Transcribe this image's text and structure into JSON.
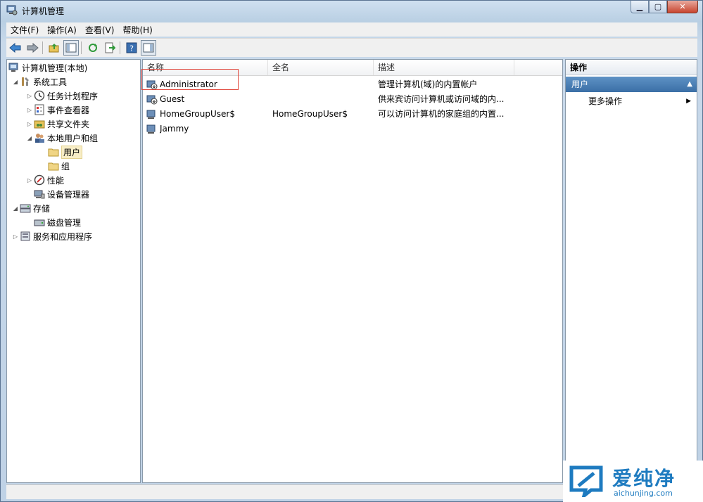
{
  "window": {
    "title": "计算机管理"
  },
  "menu": [
    "文件(F)",
    "操作(A)",
    "查看(V)",
    "帮助(H)"
  ],
  "tree": {
    "root": "计算机管理(本地)",
    "items": [
      {
        "label": "系统工具"
      },
      {
        "label": "任务计划程序"
      },
      {
        "label": "事件查看器"
      },
      {
        "label": "共享文件夹"
      },
      {
        "label": "本地用户和组"
      },
      {
        "label": "用户"
      },
      {
        "label": "组"
      },
      {
        "label": "性能"
      },
      {
        "label": "设备管理器"
      },
      {
        "label": "存储"
      },
      {
        "label": "磁盘管理"
      },
      {
        "label": "服务和应用程序"
      }
    ]
  },
  "list": {
    "columns": [
      "名称",
      "全名",
      "描述"
    ],
    "rows": [
      {
        "name": "Administrator",
        "fullname": "",
        "desc": "管理计算机(域)的内置帐户"
      },
      {
        "name": "Guest",
        "fullname": "",
        "desc": "供来宾访问计算机或访问域的内..."
      },
      {
        "name": "HomeGroupUser$",
        "fullname": "HomeGroupUser$",
        "desc": "可以访问计算机的家庭组的内置..."
      },
      {
        "name": "Jammy",
        "fullname": "",
        "desc": ""
      }
    ]
  },
  "actions": {
    "title": "操作",
    "section": "用户",
    "more": "更多操作"
  },
  "watermark": {
    "brand": "爱纯净",
    "url": "aichunjing.com"
  },
  "colors": {
    "accent": "#3b6fa6",
    "highlight": "#e0453a",
    "watermark": "#1e7bc0"
  }
}
